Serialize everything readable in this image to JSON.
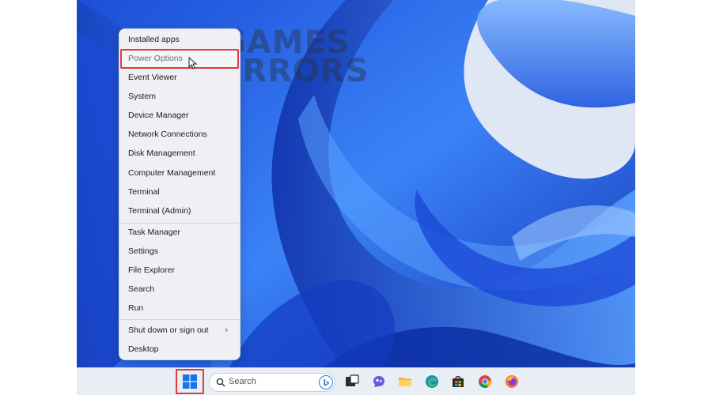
{
  "watermark": {
    "line1": "GAMES",
    "line2": "ERRORS"
  },
  "menu": {
    "items": [
      {
        "label": "Installed apps"
      },
      {
        "label": "Power Options",
        "highlighted": true
      },
      {
        "label": "Event Viewer"
      },
      {
        "label": "System"
      },
      {
        "label": "Device Manager"
      },
      {
        "label": "Network Connections"
      },
      {
        "label": "Disk Management"
      },
      {
        "label": "Computer Management"
      },
      {
        "label": "Terminal"
      },
      {
        "label": "Terminal (Admin)"
      },
      {
        "label": "Task Manager"
      },
      {
        "label": "Settings"
      },
      {
        "label": "File Explorer"
      },
      {
        "label": "Search"
      },
      {
        "label": "Run"
      },
      {
        "label": "Shut down or sign out",
        "has_submenu": true
      },
      {
        "label": "Desktop"
      }
    ],
    "submenu_chevron": "›"
  },
  "taskbar": {
    "search_placeholder": "Search",
    "icons": [
      "start-icon",
      "search-icon",
      "bing-icon",
      "task-view-icon",
      "chat-icon",
      "file-explorer-icon",
      "edge-icon",
      "store-icon",
      "chrome-icon",
      "firefox-icon"
    ]
  },
  "colors": {
    "highlight_frame": "#e23b3b",
    "wallpaper": "#2f6fe6",
    "menu_bg": "#eef0f3",
    "taskbar_bg": "#e9eef5"
  }
}
